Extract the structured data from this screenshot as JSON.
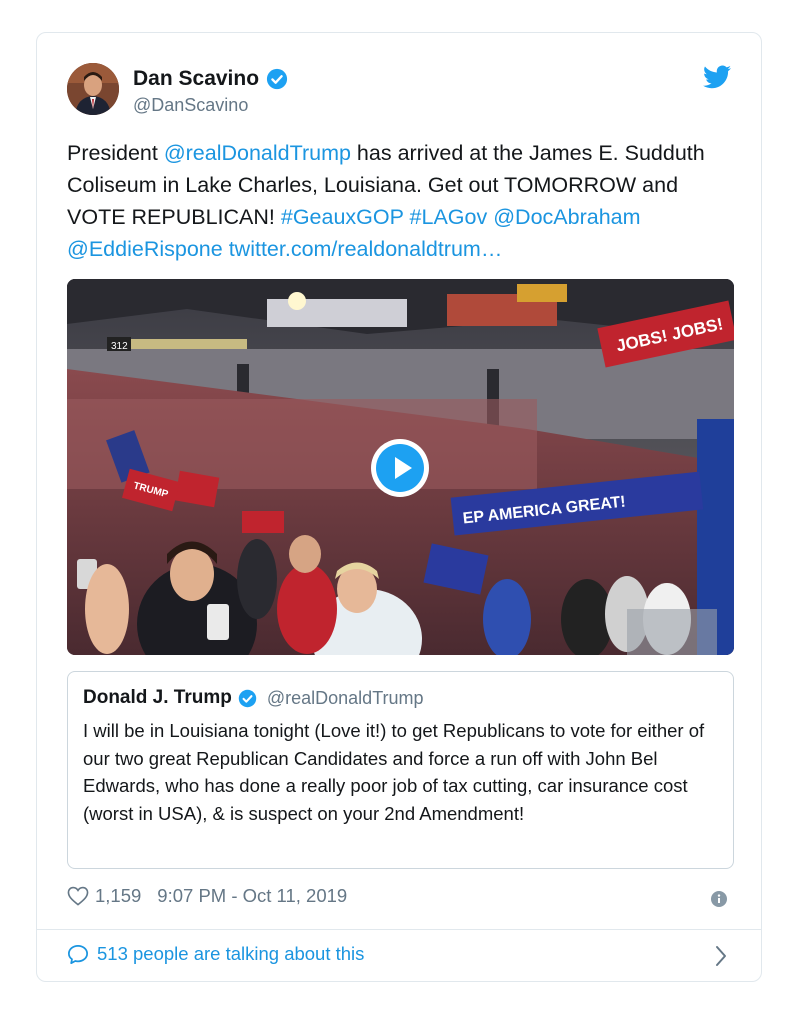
{
  "tweet": {
    "author_name": "Dan Scavino",
    "author_handle": "@DanScavino",
    "text_parts": {
      "t1": "President ",
      "m1": "@realDonaldTrump",
      "t2": " has arrived at the James E. Sudduth Coliseum in Lake Charles, Louisiana. Get out TOMORROW and VOTE REPUBLICAN! ",
      "h1": "#GeauxGOP",
      "s1": " ",
      "h2": "#LAGov",
      "s2": " ",
      "m2": "@DocAbraham",
      "s3": " ",
      "m3": "@EddieRispone",
      "s4": " ",
      "l1": "twitter.com/realdonaldtrum…"
    },
    "media": {
      "section_number": "312",
      "banner_jobs": "JOBS!  JOBS!",
      "banner_main": "EP AMERICA GREAT!",
      "sign_text": "TRUMP"
    },
    "quoted": {
      "name": "Donald J. Trump",
      "handle": "@realDonaldTrump",
      "text": "I will be in Louisiana tonight (Love it!) to get Republicans to vote for either of our two great Republican Candidates and force a run off with John Bel Edwards, who has done a really poor job of tax cutting, car insurance cost (worst in USA), & is suspect on your 2nd Amendment!"
    },
    "likes": "1,159",
    "timestamp": "9:07 PM - Oct 11, 2019",
    "talking": "513 people are talking about this"
  },
  "colors": {
    "link": "#1b95e0",
    "twitter_blue": "#1da1f2",
    "muted": "#657786"
  },
  "icons": [
    "verified-badge-icon",
    "twitter-bird-icon",
    "play-icon",
    "heart-icon",
    "info-icon",
    "speech-bubble-icon",
    "chevron-right-icon"
  ]
}
